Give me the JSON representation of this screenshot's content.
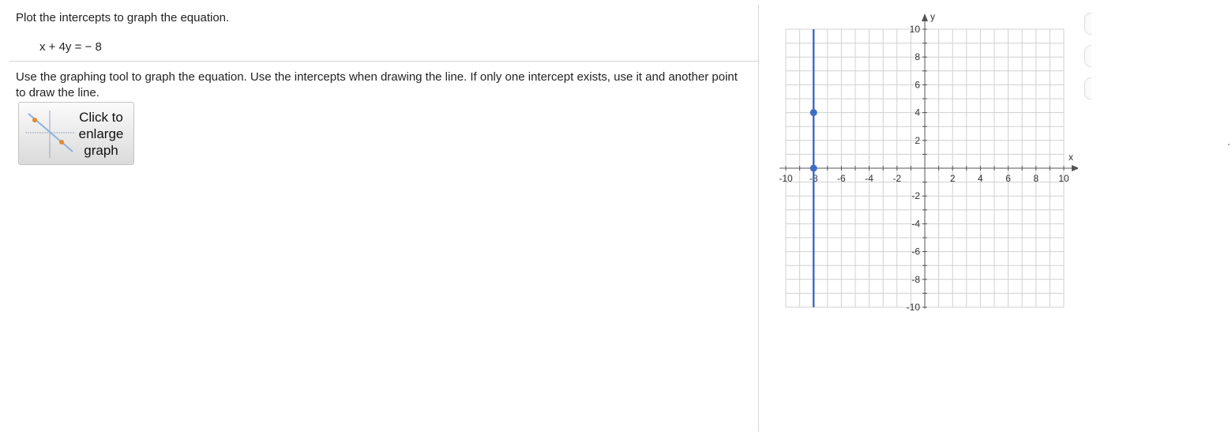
{
  "question": {
    "title": "Plot the intercepts to graph the equation.",
    "equation": "x + 4y =  − 8"
  },
  "instructions": {
    "text": "Use the graphing tool to graph the equation.  Use the intercepts when drawing the line.  If only one intercept exists, use it and another point to draw the line."
  },
  "enlarge_button": {
    "label": "Click to\nenlarge\ngraph",
    "icon": "graph-thumbnail-icon"
  },
  "colors": {
    "line": "#3d6fc6",
    "grid": "#d0d0d0",
    "axis": "#555555",
    "icon_point": "#e08a2e"
  },
  "chart_data": {
    "type": "line",
    "title": "",
    "xlabel": "x",
    "ylabel": "y",
    "xlim": [
      -10,
      10
    ],
    "ylim": [
      -10,
      10
    ],
    "grid": true,
    "grid_step": 1,
    "x_tick_labels": [
      "-10",
      "-8",
      "-6",
      "-4",
      "-2",
      "2",
      "4",
      "6",
      "8",
      "10"
    ],
    "y_tick_labels": [
      "10",
      "8",
      "6",
      "4",
      "2",
      "-2",
      "-4",
      "-6",
      "-8",
      "-10"
    ],
    "series": [
      {
        "x": [
          -8,
          -8
        ],
        "y": [
          -10,
          10
        ]
      }
    ],
    "points": [
      {
        "x": -8,
        "y": 4
      },
      {
        "x": -8,
        "y": 0
      }
    ]
  }
}
